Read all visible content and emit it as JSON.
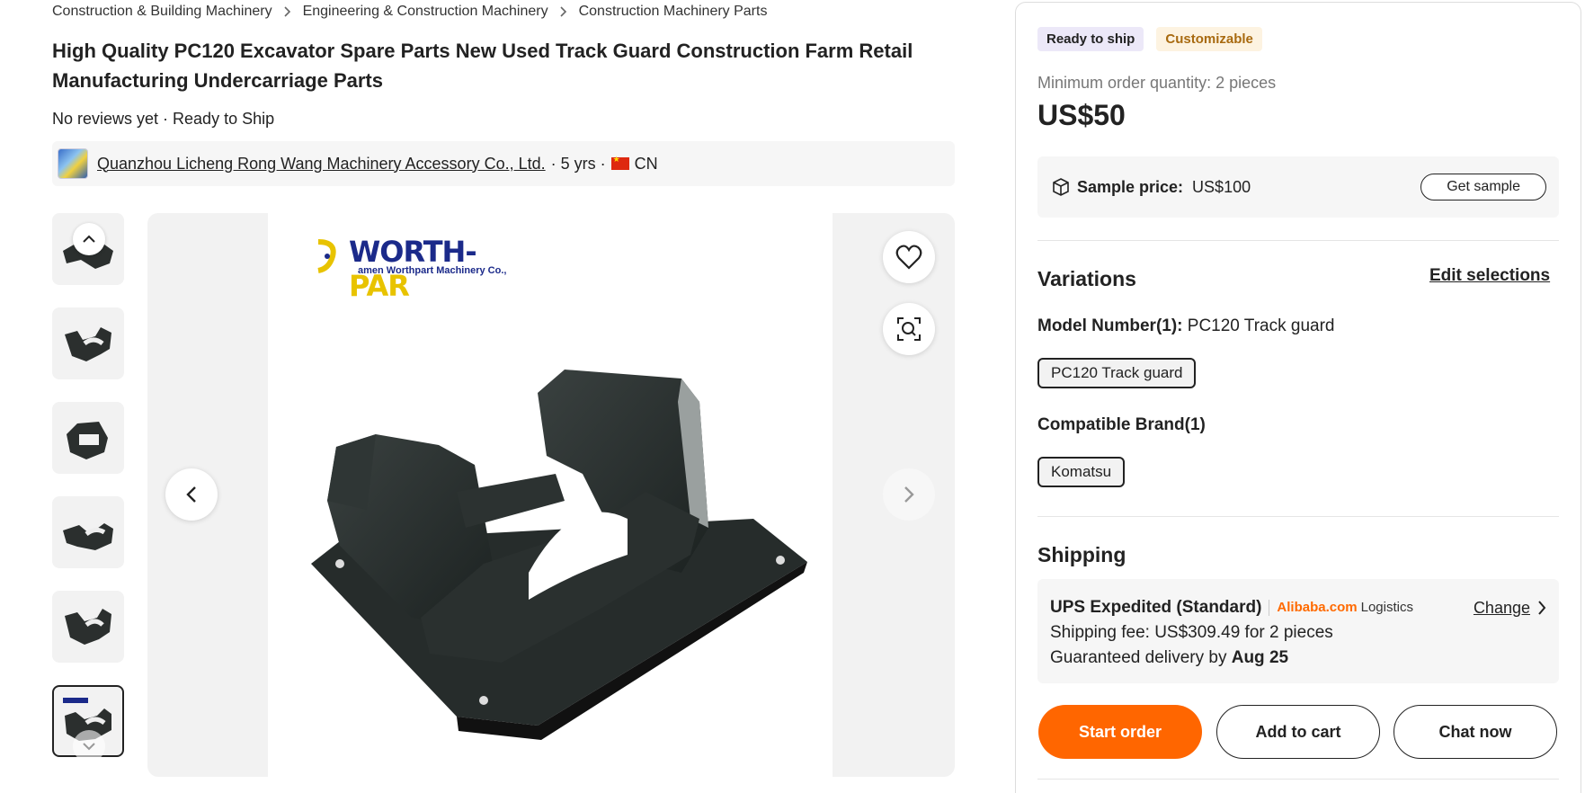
{
  "breadcrumb": [
    "Construction & Building Machinery",
    "Engineering & Construction Machinery",
    "Construction Machinery Parts"
  ],
  "product": {
    "title": "High Quality PC120 Excavator Spare Parts New Used Track Guard Construction Farm Retail Manufacturing Undercarriage Parts",
    "meta": "No reviews yet · Ready to Ship"
  },
  "supplier": {
    "name": "Quanzhou Licheng Rong Wang Machinery Accessory Co., Ltd.",
    "years": "· 5 yrs ·",
    "country": "CN"
  },
  "gallery": {
    "thumb_count": 6,
    "active_index": 5,
    "brand_logo_text_a": "WORTH-",
    "brand_logo_text_b": "PAR",
    "brand_logo_sub": "amen Worthpart Machinery Co.,"
  },
  "panel": {
    "tags": [
      "Ready to ship",
      "Customizable"
    ],
    "moq": "Minimum order quantity: 2 pieces",
    "price": "US$50",
    "sample_label": "Sample price:",
    "sample_value": "US$100",
    "sample_button": "Get sample",
    "variations_heading": "Variations",
    "edit_selections": "Edit selections",
    "model_label": "Model Number(1):",
    "model_value": "PC120 Track guard",
    "model_chip": "PC120 Track guard",
    "brand_label": "Compatible Brand(1)",
    "brand_chip": "Komatsu",
    "shipping_heading": "Shipping",
    "ship_method": "UPS Expedited (Standard)",
    "ship_alibaba": "Alibaba.com",
    "ship_logistics": "Logistics",
    "ship_change": "Change",
    "ship_fee": "Shipping fee: US$309.49 for 2 pieces",
    "ship_delivery_prefix": "Guaranteed delivery by ",
    "ship_delivery_date": "Aug 25",
    "btn_start": "Start order",
    "btn_cart": "Add to cart",
    "btn_chat": "Chat now"
  },
  "colors": {
    "accent": "#ff6600",
    "custom_tag": "#a86a10",
    "brand_blue": "#1b2a8a"
  }
}
